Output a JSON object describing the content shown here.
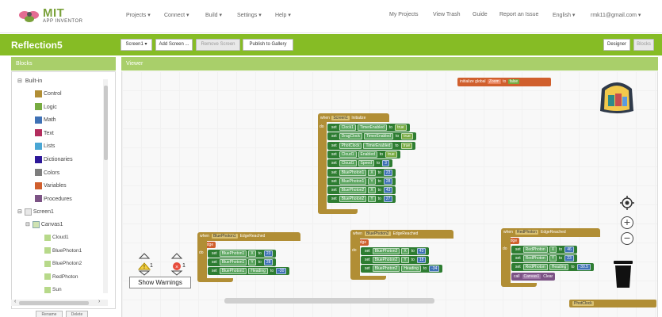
{
  "logo": {
    "name": "MIT",
    "subtitle": "APP INVENTOR"
  },
  "nav": {
    "left": [
      "Projects ▾",
      "Connect ▾",
      "Build ▾",
      "Settings ▾",
      "Help ▾"
    ],
    "right": [
      "My Projects",
      "View Trash",
      "Guide",
      "Report an Issue",
      "English ▾",
      "rmk11@gmail.com ▾"
    ]
  },
  "project": {
    "title": "Reflection5",
    "buttons": [
      "Screen1 ▾",
      "Add Screen ...",
      "Remove Screen",
      "Publish to Gallery"
    ],
    "mode_buttons": [
      "Designer",
      "Blocks"
    ]
  },
  "panels": {
    "blocks_header": "Blocks",
    "viewer_header": "Viewer"
  },
  "blocks_tree": {
    "builtin_label": "Built-in",
    "builtin": [
      {
        "label": "Control",
        "color": "#b18e35"
      },
      {
        "label": "Logic",
        "color": "#77ab41"
      },
      {
        "label": "Math",
        "color": "#3f71b5"
      },
      {
        "label": "Text",
        "color": "#b32d5e"
      },
      {
        "label": "Lists",
        "color": "#49a6d4"
      },
      {
        "label": "Dictionaries",
        "color": "#2d1799"
      },
      {
        "label": "Colors",
        "color": "#7d7d7d"
      },
      {
        "label": "Variables",
        "color": "#d05f2d"
      },
      {
        "label": "Procedures",
        "color": "#7c5385"
      }
    ],
    "screen": "Screen1",
    "canvas": "Canvas1",
    "components": [
      "Cloud1",
      "BluePhoton1",
      "BluePhoton2",
      "RedPhoton",
      "Sun"
    ],
    "buttons": [
      "Rename",
      "Delete"
    ]
  },
  "canvas": {
    "global_init": {
      "initialize": "initialize global",
      "name": "Zoom",
      "to": "to",
      "value": "false"
    },
    "screen_init": {
      "event": "when",
      "component": "Screen1",
      "event_name": "Initialize",
      "do": "do",
      "set": "set",
      "to": "to",
      "rows": [
        {
          "comp": "Clock1",
          "prop": "TimerEnabled",
          "val": "true",
          "logic": true
        },
        {
          "comp": "DragClock",
          "prop": "TimerEnabled",
          "val": "true",
          "logic": true
        },
        {
          "comp": "PhotClock",
          "prop": "TimerEnabled",
          "val": "true",
          "logic": true
        },
        {
          "comp": "Cloud1",
          "prop": "Enabled",
          "val": "true",
          "logic": true
        },
        {
          "comp": "Cloud1",
          "prop": "Speed",
          "val": "3",
          "logic": false
        },
        {
          "comp": "BluePhoton1",
          "prop": "X",
          "val": "23",
          "logic": false
        },
        {
          "comp": "BluePhoton1",
          "prop": "Y",
          "val": "28",
          "logic": false
        },
        {
          "comp": "BluePhoton2",
          "prop": "X",
          "val": "43",
          "logic": false
        },
        {
          "comp": "BluePhoton2",
          "prop": "Y",
          "val": "27",
          "logic": false
        }
      ]
    },
    "edge_blocks": [
      {
        "component": "BluePhoton1",
        "event_name": "EdgeReached",
        "param": "edge",
        "rows": [
          {
            "comp": "BluePhoton1",
            "prop": "X",
            "val": "23"
          },
          {
            "comp": "BluePhoton1",
            "prop": "Y",
            "val": "28"
          },
          {
            "comp": "BluePhoton1",
            "prop": "Heading",
            "val": "-30"
          }
        ]
      },
      {
        "component": "BluePhoton2",
        "event_name": "EdgeReached",
        "param": "edge",
        "rows": [
          {
            "comp": "BluePhoton2",
            "prop": "X",
            "val": "43"
          },
          {
            "comp": "BluePhoton2",
            "prop": "Y",
            "val": "18"
          },
          {
            "comp": "BluePhoton2",
            "prop": "Heading",
            "val": "-34"
          }
        ]
      },
      {
        "component": "RedPhoton",
        "event_name": "EdgeReached",
        "param": "edge",
        "rows": [
          {
            "comp": "RedPhoton",
            "prop": "X",
            "val": "46"
          },
          {
            "comp": "RedPhoton",
            "prop": "Y",
            "val": "23"
          },
          {
            "comp": "RedPhoton",
            "prop": "Heading",
            "val": "-30.5"
          }
        ],
        "call": {
          "label": "call",
          "comp": "Canvas1",
          "method": "Clear"
        }
      }
    ],
    "partial_block": "PhotClock"
  },
  "warnings": {
    "warn_count": "1",
    "error_count": "1",
    "button": "Show Warnings"
  },
  "colors": {
    "accent": "#86bc25",
    "accent_light": "#a9cf6a",
    "event_block": "#b18e35",
    "setter_block": "#2e7d32",
    "component_block": "#388e3c",
    "math_block": "#3f71b5",
    "logic_block": "#77ab41",
    "variable_block": "#d05f2d",
    "red_block": "#c0392b"
  },
  "icons": [
    "bee-logo-icon",
    "backpack-icon",
    "target-icon",
    "zoom-in-icon",
    "zoom-out-icon",
    "trash-icon",
    "warning-icon",
    "error-icon"
  ]
}
